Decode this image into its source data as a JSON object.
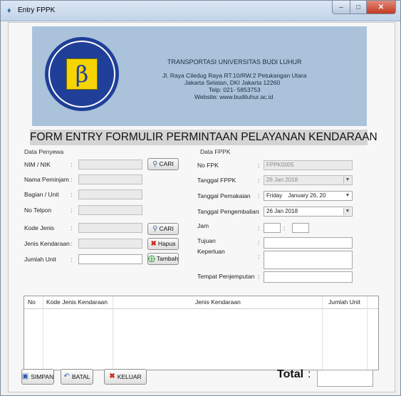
{
  "window": {
    "title": "Entry FPPK",
    "controls": {
      "minimize": "–",
      "maximize": "□",
      "close": "✕"
    }
  },
  "header": {
    "lines": [
      "TRANSPORTASI UNIVERSITAS BUDI LUHUR",
      "Jl. Raya Ciledug Raya RT.10/RW.2 Petukangan Utara",
      "Jakarta Selatan, DKI Jakarta 12260",
      "Telp: 021- 5853753",
      "Website: www.budiluhur.ac.id"
    ]
  },
  "form_title": "FORM ENTRY FORMULIR PERMINTAAN PELAYANAN KENDARAAN",
  "data_penyewa": {
    "group_label": "Data Penyewa",
    "labels": {
      "nim": "NIM / NIK",
      "nama": "Nama Peminjam",
      "bagian": "Bagian / Unit",
      "telpon": "No Telpon",
      "kode_jenis": "Kode Jenis",
      "jenis_kendaraan": "Jenis Kendaraan",
      "jumlah_unit": "Jumlah Unit"
    },
    "colon": ":",
    "buttons": {
      "cari": "CARI",
      "hapus": "Hapus",
      "tambah": "Tambah"
    }
  },
  "data_fppk": {
    "group_label": "Data FPPK",
    "labels": {
      "no_fpk": "No FPK",
      "tgl_fppk": "Tanggal FPPK",
      "tgl_pemakaian": "Tanggal Pemakaian",
      "tgl_pengembalian": "Tanggal Pengembalian",
      "jam": "Jam",
      "tujuan": "Tujuan",
      "keperluan": "Keperluan",
      "tempat": "Tempat Penjemputan"
    },
    "values": {
      "no_fpk": "FPPK0005",
      "tgl_fppk": "26 Jan 2018",
      "tgl_pemakaian_day": "Friday",
      "tgl_pemakaian_date": "January  26, 20",
      "tgl_pengembalian": "26 Jan 2018"
    },
    "colon": ":"
  },
  "grid": {
    "columns": [
      "No",
      "Kode Jenis Kendaraan",
      "Jenis Kendaraan",
      "Jumlah Unit"
    ]
  },
  "bottom": {
    "buttons": {
      "simpan": "SIMPAN",
      "batal": "BATAL",
      "keluar": "KELUAR"
    },
    "total_label": "Total",
    "total_colon": ":"
  },
  "colors": {
    "banner": "#aac3db",
    "logo_blue": "#1f3f98",
    "logo_yellow": "#f5d400",
    "close_red": "#c23a23"
  }
}
